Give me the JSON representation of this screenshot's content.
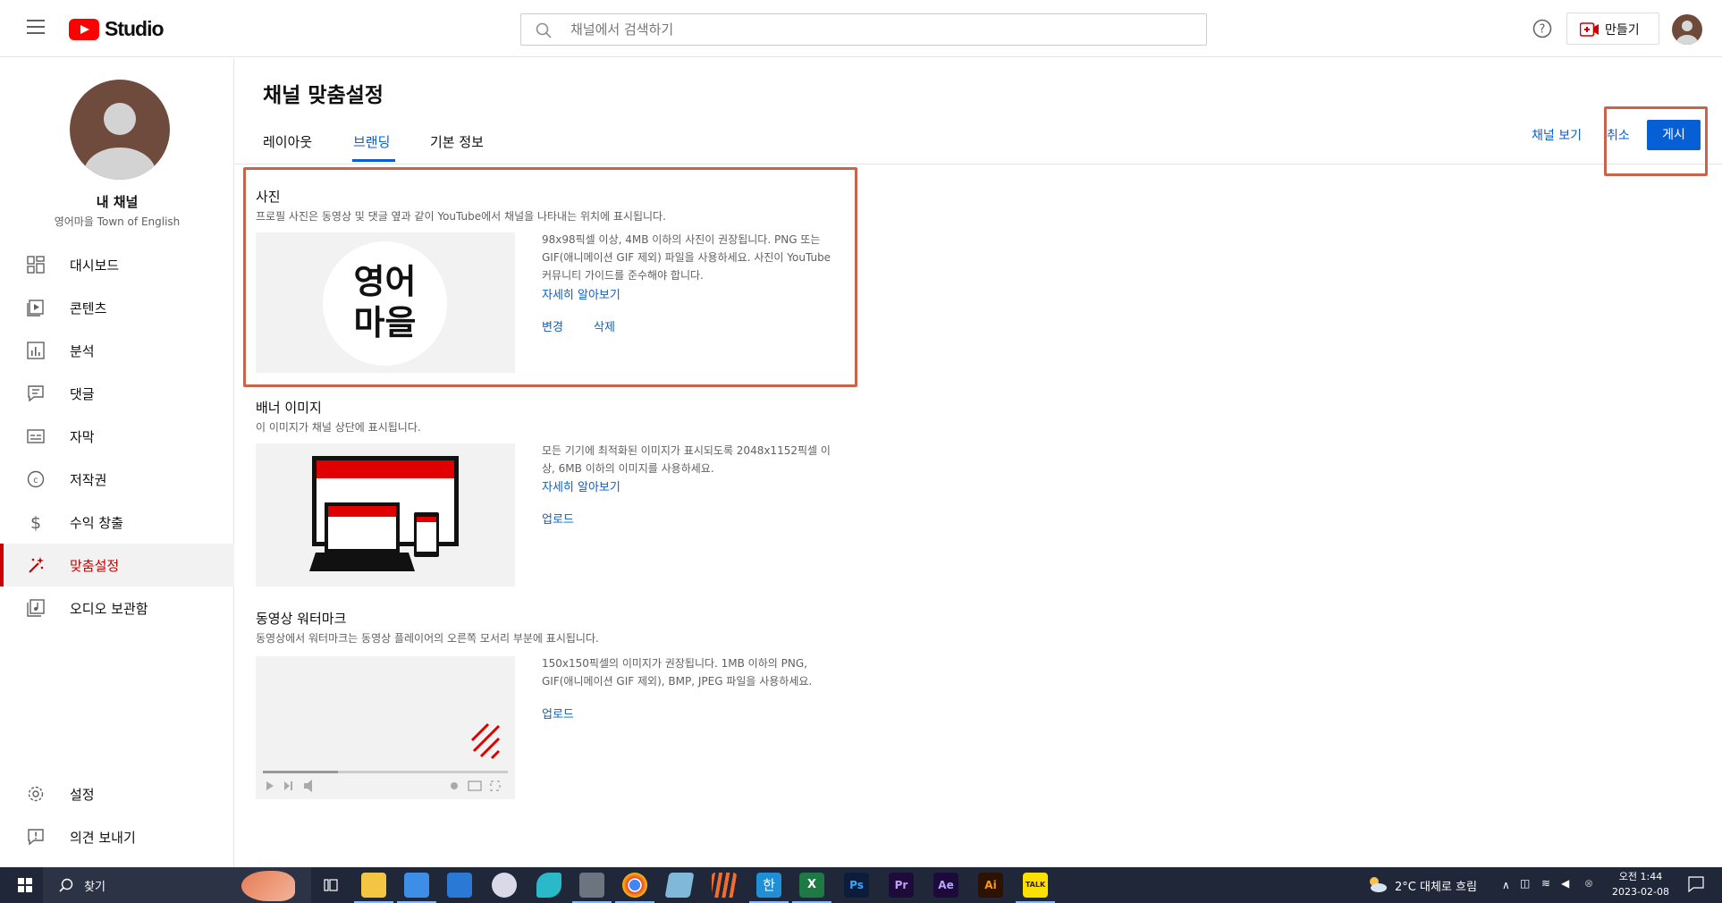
{
  "header": {
    "logo_text": "Studio",
    "search_placeholder": "채널에서 검색하기",
    "create_label": "만들기"
  },
  "sidebar": {
    "title": "내 채널",
    "channel_name": "영어마을 Town of English",
    "items": [
      {
        "label": "대시보드",
        "icon": "dashboard-icon"
      },
      {
        "label": "콘텐츠",
        "icon": "content-icon"
      },
      {
        "label": "분석",
        "icon": "analytics-icon"
      },
      {
        "label": "댓글",
        "icon": "comments-icon"
      },
      {
        "label": "자막",
        "icon": "subtitles-icon"
      },
      {
        "label": "저작권",
        "icon": "copyright-icon"
      },
      {
        "label": "수익 창출",
        "icon": "monetization-icon"
      },
      {
        "label": "맞춤설정",
        "icon": "customization-icon",
        "active": true
      },
      {
        "label": "오디오 보관함",
        "icon": "audio-library-icon"
      }
    ],
    "bottom": [
      {
        "label": "설정",
        "icon": "settings-icon"
      },
      {
        "label": "의견 보내기",
        "icon": "feedback-icon"
      }
    ]
  },
  "page": {
    "title": "채널 맞춤설정",
    "tabs": [
      "레이아웃",
      "브랜딩",
      "기본 정보"
    ],
    "active_tab": "브랜딩",
    "view_channel": "채널 보기",
    "cancel": "취소",
    "publish": "게시"
  },
  "sections": {
    "photo": {
      "title": "사진",
      "desc": "프로필 사진은 동영상 및 댓글 옆과 같이 YouTube에서 채널을 나타내는 위치에 표시됩니다.",
      "preview_line1": "영어",
      "preview_line2": "마을",
      "info": "98x98픽셀 이상, 4MB 이하의 사진이 권장됩니다. PNG 또는 GIF(애니메이션 GIF 제외) 파일을 사용하세요. 사진이 YouTube 커뮤니티 가이드를 준수해야 합니다.",
      "learn_more": "자세히 알아보기",
      "change": "변경",
      "delete": "삭제"
    },
    "banner": {
      "title": "배너 이미지",
      "desc": "이 이미지가 채널 상단에 표시됩니다.",
      "info": "모든 기기에 최적화된 이미지가 표시되도록 2048x1152픽셀 이상, 6MB 이하의 이미지를 사용하세요.",
      "learn_more": "자세히 알아보기",
      "upload": "업로드"
    },
    "watermark": {
      "title": "동영상 워터마크",
      "desc": "동영상에서 워터마크는 동영상 플레이어의 오른쪽 모서리 부분에 표시됩니다.",
      "info": "150x150픽셀의 이미지가 권장됩니다. 1MB 이하의 PNG, GIF(애니메이션 GIF 제외), BMP, JPEG 파일을 사용하세요.",
      "upload": "업로드"
    }
  },
  "taskbar": {
    "search_label": "찾기",
    "weather": "2°C  대체로 흐림",
    "time": "오전 1:44",
    "date": "2023-02-08",
    "kakao_label": "TALK",
    "apps": [
      "task-view",
      "file-explorer",
      "store",
      "mail",
      "paint",
      "app-bird",
      "calculator",
      "chrome",
      "notepad",
      "stripes",
      "hangul",
      "excel",
      "photoshop",
      "premiere",
      "after-effects",
      "illustrator",
      "kakaotalk"
    ],
    "app_labels": {
      "photoshop": "Ps",
      "premiere": "Pr",
      "after-effects": "Ae",
      "illustrator": "Ai",
      "excel": "X",
      "hangul": "한"
    },
    "colors": {
      "accent": "#065fd4",
      "active": "#cc0000",
      "highlight": "#c8644a",
      "taskbar": "#1f2738"
    }
  }
}
